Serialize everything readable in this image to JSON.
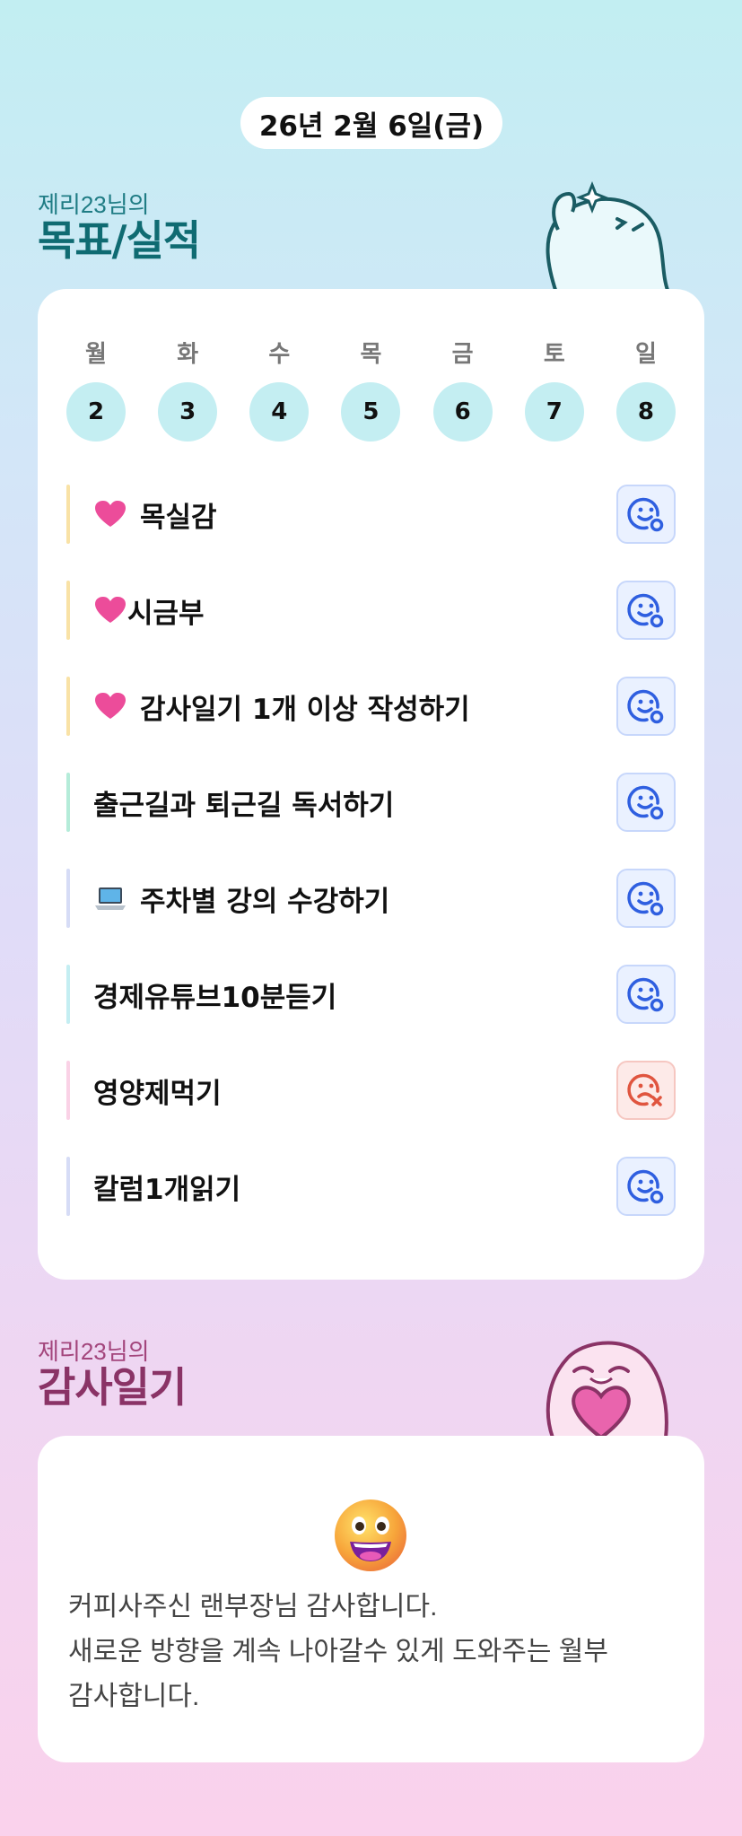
{
  "date": "26년 2월 6일(금)",
  "goals_section": {
    "subtitle": "제리23님의",
    "title": "목표/실적"
  },
  "week": [
    {
      "name": "월",
      "num": "2"
    },
    {
      "name": "화",
      "num": "3"
    },
    {
      "name": "수",
      "num": "4"
    },
    {
      "name": "목",
      "num": "5"
    },
    {
      "name": "금",
      "num": "6"
    },
    {
      "name": "토",
      "num": "7"
    },
    {
      "name": "일",
      "num": "8"
    }
  ],
  "goals": [
    {
      "label": "목실감",
      "emoji": "heart",
      "bar_color": "#f9e2a6",
      "status": "done"
    },
    {
      "label": "시금부",
      "emoji": "heart",
      "bar_color": "#f9e2a6",
      "status": "done"
    },
    {
      "label": "감사일기 1개 이상 작성하기",
      "emoji": "heart",
      "bar_color": "#f9e2a6",
      "status": "done"
    },
    {
      "label": "출근길과 퇴근길 독서하기",
      "emoji": "",
      "bar_color": "#b5ecd9",
      "status": "done"
    },
    {
      "label": "주차별 강의 수강하기",
      "emoji": "laptop",
      "bar_color": "#d6dcf6",
      "status": "done"
    },
    {
      "label": "경제유튜브10분듣기",
      "emoji": "",
      "bar_color": "#c4eef2",
      "status": "done"
    },
    {
      "label": "영양제먹기",
      "emoji": "",
      "bar_color": "#fad2e6",
      "status": "failed"
    },
    {
      "label": "칼럼1개읽기",
      "emoji": "",
      "bar_color": "#d6dcf6",
      "status": "done"
    }
  ],
  "diary_section": {
    "subtitle": "제리23님의",
    "title": "감사일기"
  },
  "diary": {
    "emoji": "grinning-face",
    "lines": [
      "커피사주신 랜부장님 감사합니다.",
      "새로운 방향을 계속 나아갈수 있게 도와주는 월부",
      "감사합니다."
    ]
  },
  "colors": {
    "accent_teal": "#0f6b72",
    "accent_pink": "#8a3366",
    "day_circle": "#c4eef2",
    "status_ok": "#2f5fe0",
    "status_fail": "#e0553f"
  }
}
